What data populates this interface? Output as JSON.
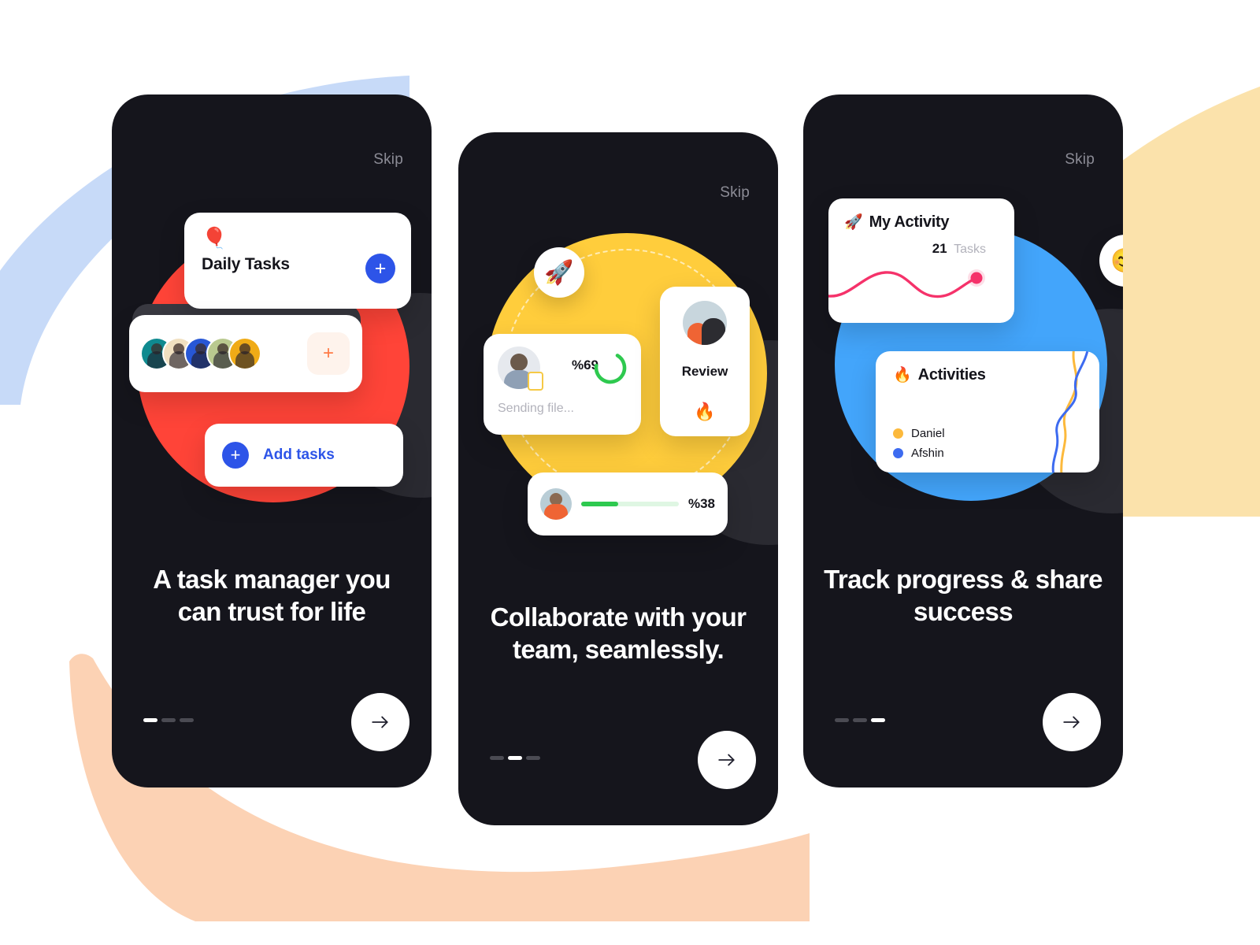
{
  "colors": {
    "phone_bg": "#15151c",
    "accent_blue": "#2d54e8",
    "red_circle": "#ff4438",
    "yellow_circle": "#ffcd3c",
    "blue_circle": "#43a5fb",
    "bg_blue_wedge": "#c7daf8",
    "bg_yellow_wedge": "#fbe2ab",
    "bg_peach_arc": "#fcd2b4",
    "green_progress": "#2ec94f",
    "pink_line": "#f5326a",
    "daniel_yellow": "#fcb93c",
    "afshin_blue": "#3d6bf0",
    "orange_accent": "#ff7a45"
  },
  "screens": [
    {
      "skip_label": "Skip",
      "headline": "A task manager you can trust for life",
      "pager": {
        "total": 3,
        "active": 1
      },
      "next_icon": "arrow-right-icon",
      "daily_card": {
        "emoji": "🎈",
        "emoji_name": "balloon-emoji",
        "title": "Daily Tasks",
        "add_button_glyph": "+"
      },
      "avatars_card": {
        "avatar_colors": [
          "#0f8a8f",
          "#f1e0c0",
          "#2757d6",
          "#b9c98f",
          "#f0ab16"
        ],
        "add_button_glyph": "+"
      },
      "add_tasks_card": {
        "label": "Add tasks",
        "icon_glyph": "+"
      }
    },
    {
      "skip_label": "Skip",
      "headline": "Collaborate with your team, seamlessly.",
      "pager": {
        "total": 3,
        "active": 2
      },
      "next_icon": "arrow-right-icon",
      "rocket_bubble": {
        "emoji": "🚀",
        "emoji_name": "rocket-emoji"
      },
      "sending_card": {
        "percent_label": "%69",
        "percent_value": 69,
        "status": "Sending file..."
      },
      "review_card": {
        "title": "Review",
        "emoji": "🔥",
        "emoji_name": "fire-emoji"
      },
      "progress_card": {
        "percent_label": "%38",
        "percent_value": 38
      }
    },
    {
      "skip_label": "Skip",
      "headline": "Track progress & success",
      "headline_full": "Track progress & share success",
      "pager": {
        "total": 3,
        "active": 3
      },
      "next_icon": "arrow-right-icon",
      "smiley_bubble": {
        "emoji": "😊",
        "emoji_name": "smiling-face-emoji"
      },
      "my_activity_card": {
        "emoji": "🚀",
        "emoji_name": "rocket-emoji",
        "title": "My Activity",
        "count": "21",
        "count_word": "Tasks"
      },
      "activities_card": {
        "emoji": "🔥",
        "emoji_name": "fire-emoji",
        "title": "Activities",
        "legend": [
          {
            "name": "Daniel",
            "color": "#fcb93c"
          },
          {
            "name": "Afshin",
            "color": "#3d6bf0"
          }
        ]
      }
    }
  ]
}
